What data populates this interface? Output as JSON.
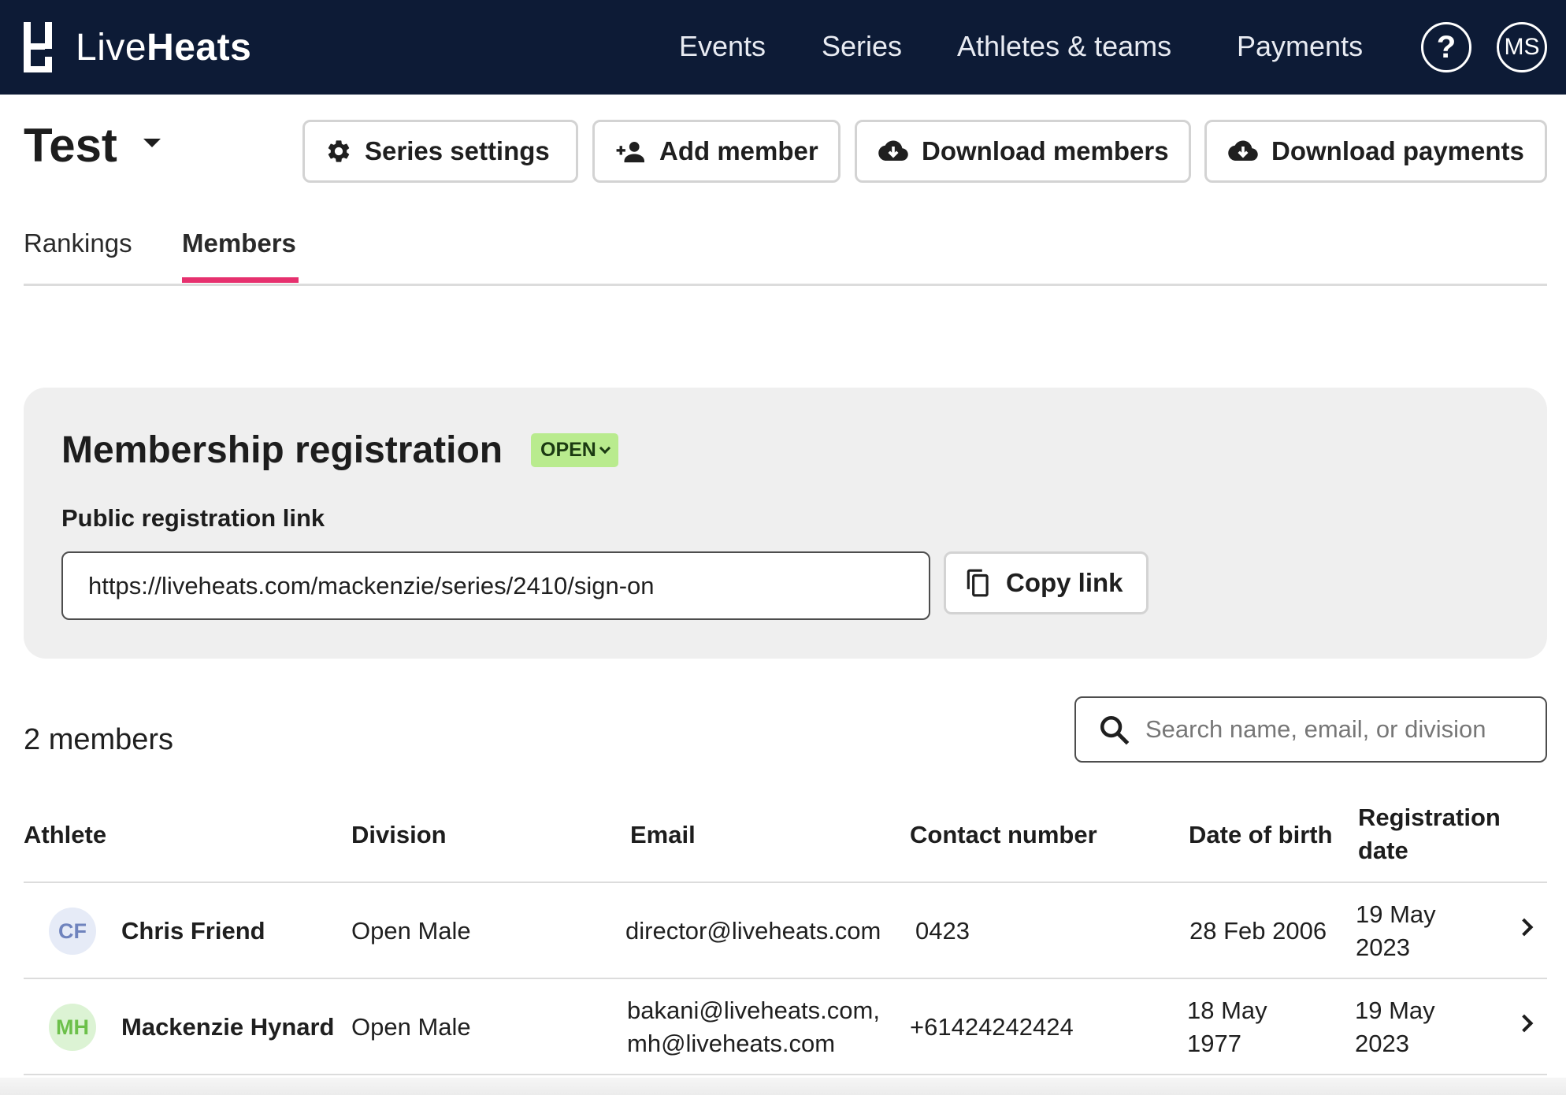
{
  "brand": {
    "name_light": "Live",
    "name_bold": "Heats"
  },
  "nav": {
    "items": [
      "Events",
      "Series",
      "Athletes & teams",
      "Payments"
    ],
    "help_label": "?",
    "user_initials": "MS"
  },
  "page": {
    "title": "Test",
    "actions": {
      "series_settings": "Series settings",
      "add_member": "Add member",
      "download_members": "Download members",
      "download_payments": "Download payments"
    },
    "tabs": [
      {
        "label": "Rankings",
        "active": false
      },
      {
        "label": "Members",
        "active": true
      }
    ]
  },
  "registration": {
    "title": "Membership registration",
    "status": "OPEN",
    "status_color": "#b9eb8e",
    "link_label": "Public registration link",
    "link_value": "https://liveheats.com/mackenzie/series/2410/sign-on",
    "copy_label": "Copy link"
  },
  "members": {
    "count_label": "2 members",
    "search_placeholder": "Search name, email, or division",
    "columns": {
      "athlete": "Athlete",
      "division": "Division",
      "email": "Email",
      "contact": "Contact number",
      "dob": "Date of birth",
      "reg_line1": "Registration",
      "reg_line2": "date"
    },
    "rows": [
      {
        "initials": "CF",
        "avatar_bg": "#e6ebf7",
        "avatar_fg": "#6f83bd",
        "name": "Chris Friend",
        "division": "Open Male",
        "email_line1": "director@liveheats.com",
        "email_line2": "",
        "contact": "0423",
        "dob_line1": "28 Feb 2006",
        "dob_line2": "",
        "reg_line1": "19 May",
        "reg_line2": "2023"
      },
      {
        "initials": "MH",
        "avatar_bg": "#dcf3d4",
        "avatar_fg": "#6cc04a",
        "name": "Mackenzie Hynard",
        "division": "Open Male",
        "email_line1": "bakani@liveheats.com,",
        "email_line2": "mh@liveheats.com",
        "contact": "+61424242424",
        "dob_line1": "18 May",
        "dob_line2": "1977",
        "reg_line1": "19 May",
        "reg_line2": "2023"
      }
    ]
  }
}
